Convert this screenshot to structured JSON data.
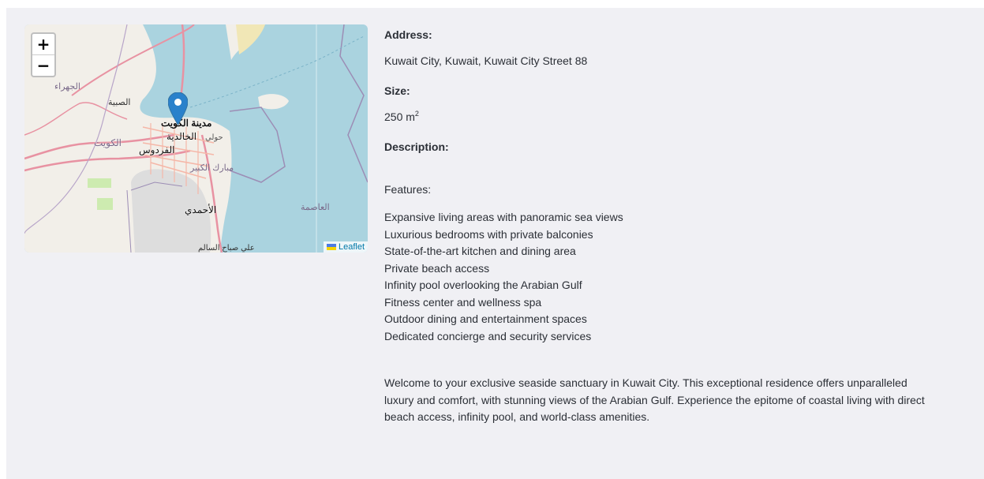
{
  "map": {
    "zoom_in": "+",
    "zoom_out": "−",
    "attribution": "Leaflet",
    "labels": {
      "jahra": "الجهراء",
      "sulaibiya": "الصبية",
      "kuwait_city": "مدينة الكويت",
      "khaldiya": "الخالدية",
      "hawalli": "حولي",
      "kuwait": "الكويت",
      "firdous": "الفردوس",
      "mubarak": "مبارك الكبير",
      "ahmadi": "الأحمدي",
      "asima": "العاصمة",
      "ali_sabah": "علي صباح السالم"
    }
  },
  "details": {
    "address_label": "Address:",
    "address_value": "Kuwait City, Kuwait, Kuwait City Street 88",
    "size_label": "Size:",
    "size_value": "250 m",
    "size_unit_sup": "2",
    "description_label": "Description:",
    "features_title": "Features:",
    "features": [
      "Expansive living areas with panoramic sea views",
      "Luxurious bedrooms with private balconies",
      "State-of-the-art kitchen and dining area",
      "Private beach access",
      "Infinity pool overlooking the Arabian Gulf",
      "Fitness center and wellness spa",
      "Outdoor dining and entertainment spaces",
      "Dedicated concierge and security services"
    ],
    "welcome": "Welcome to your exclusive seaside sanctuary in Kuwait City. This exceptional residence offers unparalleled luxury and comfort, with stunning views of the Arabian Gulf. Experience the epitome of coastal living with direct beach access, infinity pool, and world-class amenities."
  }
}
